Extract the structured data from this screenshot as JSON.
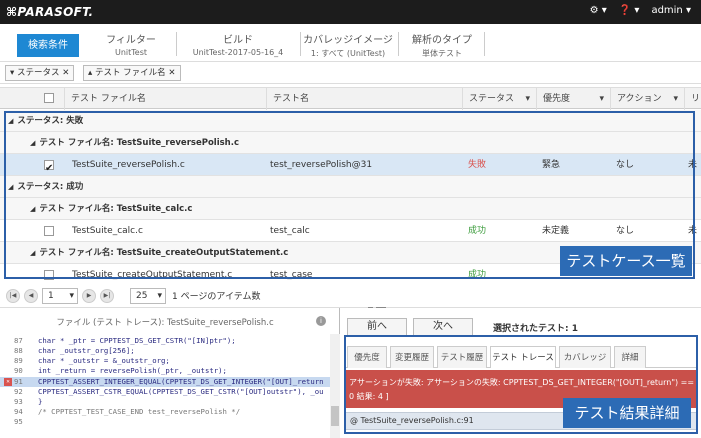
{
  "app": {
    "logo": "⌘PARASOFT.",
    "user": "admin",
    "gear_menu": "▾",
    "help_menu": "▾",
    "user_menu": "▾"
  },
  "filters": {
    "search_button": "検索条件",
    "columns": [
      {
        "header": "フィルター",
        "value": "UnitTest"
      },
      {
        "header": "ビルド",
        "value": "UnitTest-2017-05-16_4"
      },
      {
        "header": "カバレッジイメージ",
        "value": "1: すべて (UnitTest)"
      },
      {
        "header": "解析のタイプ",
        "value": "単体テスト"
      }
    ]
  },
  "chips": [
    {
      "label": "ステータス",
      "close": "✕"
    },
    {
      "label": "テスト ファイル名",
      "close": "✕"
    }
  ],
  "grid": {
    "headers": [
      "テスト ファイル名",
      "テスト名",
      "ステータス",
      "優先度",
      "アクション",
      "リ"
    ],
    "sort_glyph": "▾",
    "groups": {
      "fail": "ステータス: 失敗",
      "fail_file": "テスト ファイル名: TestSuite_reversePolish.c",
      "success": "ステータス: 成功",
      "calc_file": "テスト ファイル名: TestSuite_calc.c",
      "output_file": "テスト ファイル名: TestSuite_createOutputStatement.c"
    },
    "rows": [
      {
        "file": "TestSuite_reversePolish.c",
        "test": "test_reversePolish@31",
        "status": "失敗",
        "priority": "緊急",
        "action": "なし",
        "extra": "未"
      },
      {
        "file": "TestSuite_calc.c",
        "test": "test_calc",
        "status": "成功",
        "priority": "未定義",
        "action": "なし",
        "extra": "未"
      },
      {
        "file": "TestSuite_createOutputStatement.c",
        "test": "test_case",
        "status": "成功",
        "priority": "未定義",
        "action": "",
        "extra": ""
      }
    ],
    "callout": "テストケース一覧"
  },
  "pager": {
    "page": "1",
    "page_size": "25",
    "items_label": "1 ページのアイテム数"
  },
  "source": {
    "title": "ファイル (テスト トレース): TestSuite_reversePolish.c",
    "info": "i",
    "lines": [
      {
        "no": "87",
        "text": "char * _ptr = CPPTEST_DS_GET_CSTR(\"[IN]ptr\");"
      },
      {
        "no": "88",
        "text": "char _outstr_org[256];"
      },
      {
        "no": "89",
        "text": "char * _outstr = &_outstr_org;"
      },
      {
        "no": "90",
        "text": "int _return  = reversePolish(_ptr, _outstr);"
      },
      {
        "no": "91",
        "text": "CPPTEST_ASSERT_INTEGER_EQUAL(CPPTEST_DS_GET_INTEGER(\"[OUT]_return"
      },
      {
        "no": "92",
        "text": "CPPTEST_ASSERT_CSTR_EQUAL(CPPTEST_DS_GET_CSTR(\"[OUT]outstr\"), _ou"
      },
      {
        "no": "93",
        "text": "}"
      },
      {
        "no": "94",
        "text": "/* CPPTEST_TEST_CASE_END test_reversePolish */"
      },
      {
        "no": "95",
        "text": ""
      }
    ],
    "error_marker": "✕"
  },
  "detail": {
    "prev": "前へ",
    "next": "次へ",
    "selected": "選択されたテスト: 1",
    "tabs": [
      "優先度",
      "変更履歴",
      "テスト履歴",
      "テスト トレース",
      "カバレッジ",
      "詳細"
    ],
    "alert_line1": "アサーションが失敗: アサーションの失敗: CPPTEST_DS_GET_INTEGER(\"[OUT]_return\") == _",
    "alert_line2": "0 結果: 4 ]",
    "trace": "@ TestSuite_reversePolish.c:91",
    "callout": "テスト結果詳細"
  },
  "colors": {
    "accent": "#1e88d3",
    "fail": "#d9534f",
    "success": "#3a9b3a",
    "callout": "#2c6bb5",
    "topbar": "#1c1c1c"
  }
}
